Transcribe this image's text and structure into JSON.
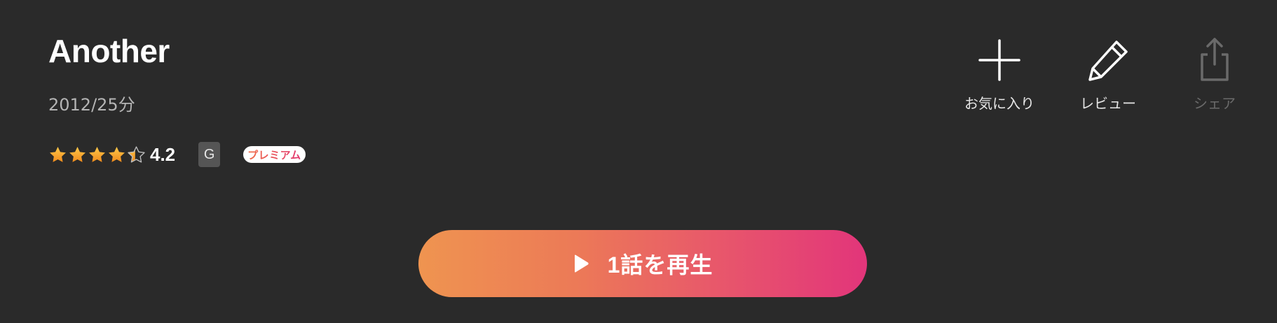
{
  "title": "Another",
  "meta": "2012/25分",
  "rating": {
    "value": "4.2",
    "stars_filled": 4.2,
    "max_stars": 5,
    "star_color": "#f5a623"
  },
  "age_rating": "G",
  "premium_badge": "プレミアム",
  "actions": {
    "favorite": {
      "label": "お気に入り",
      "icon": "plus-icon"
    },
    "review": {
      "label": "レビュー",
      "icon": "pencil-icon"
    },
    "share": {
      "label": "シェア",
      "icon": "share-icon",
      "disabled": true
    }
  },
  "play_button": {
    "label": "1話を再生",
    "icon": "play-icon",
    "gradient": [
      "#ef9450",
      "#e2357a"
    ]
  }
}
